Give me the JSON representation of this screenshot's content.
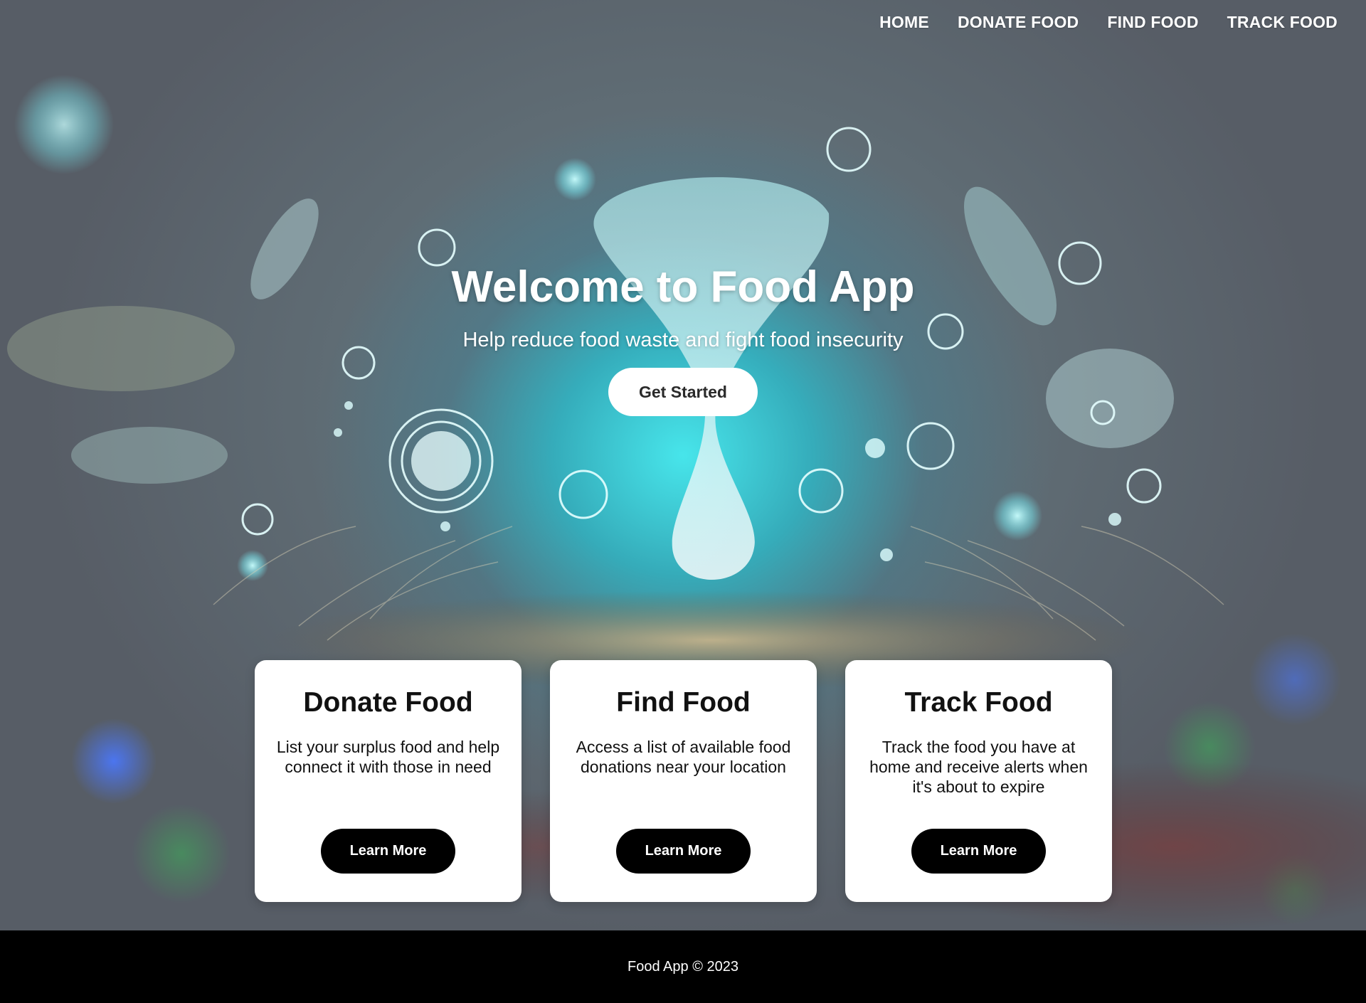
{
  "nav": {
    "items": [
      {
        "label": "HOME"
      },
      {
        "label": "DONATE FOOD"
      },
      {
        "label": "FIND FOOD"
      },
      {
        "label": "TRACK FOOD"
      }
    ]
  },
  "hero": {
    "title": "Welcome to Food App",
    "subtitle": "Help reduce food waste and fight food insecurity",
    "cta_label": "Get Started",
    "background_icon": "glowing-water-drop-bubbles-image"
  },
  "cards": [
    {
      "title": "Donate Food",
      "description": "List your surplus food and help connect it with those in need",
      "button_label": "Learn More"
    },
    {
      "title": "Find Food",
      "description": "Access a list of available food donations near your location",
      "button_label": "Learn More"
    },
    {
      "title": "Track Food",
      "description": "Track the food you have at home and receive alerts when it's about to expire",
      "button_label": "Learn More"
    }
  ],
  "footer": {
    "text": "Food App © 2023"
  },
  "colors": {
    "card_bg": "#ffffff",
    "button_dark": "#000000",
    "footer_bg": "#000000",
    "glow": "#46ebf0"
  }
}
